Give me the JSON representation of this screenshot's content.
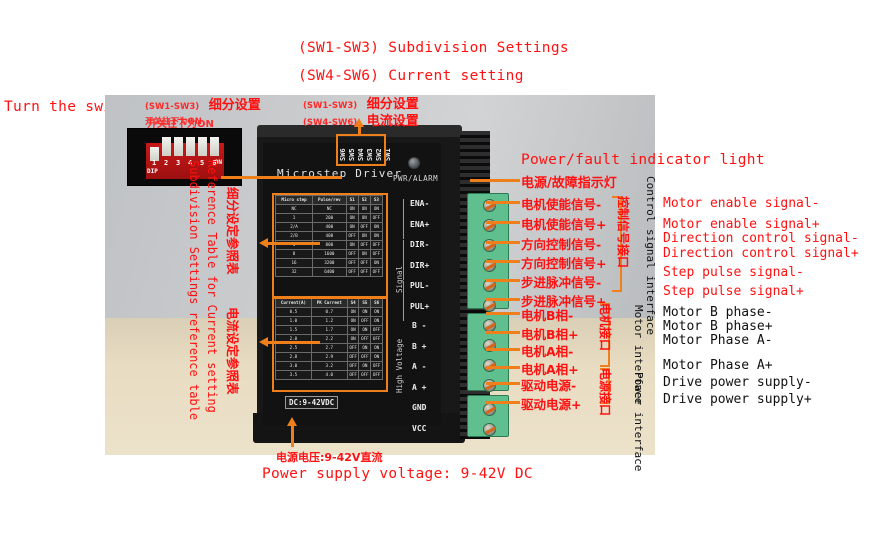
{
  "annotations": {
    "top": {
      "en_line1": "(SW1-SW3) Subdivision Settings",
      "en_line2": "(SW4-SW6) Current setting",
      "cn_line1_prefix": "(SW1-SW3)",
      "cn_line1": "细分设置",
      "cn_line2_prefix": "(SW4-SW6)",
      "cn_line2": "电流设置"
    },
    "left": {
      "en_switch": "Turn the switch downwards to ON",
      "cn_switch": "开关往下为ON",
      "en_vertical": "Reference Table for Current setting",
      "en_vertical_2": "Subdivision Settings reference table",
      "cn_vertical_1": "细分设定参照表",
      "cn_vertical_2": "电流设定参照表"
    },
    "right": {
      "indicator_en": "Power/fault indicator light",
      "indicator_cn": "电源/故障指示灯",
      "signals_cn": [
        "电机使能信号-",
        "电机使能信号+",
        "方向控制信号-",
        "方向控制信号+",
        "步进脉冲信号-",
        "步进脉冲信号+",
        "电机B相-",
        "电机B相+",
        "电机A相-",
        "电机A相+",
        "驱动电源-",
        "驱动电源+"
      ],
      "signals_en": [
        "Motor enable signal-",
        "Motor enable signal+",
        "Direction control signal-",
        "Direction control signal+",
        "Step pulse signal-",
        "Step pulse signal+",
        "Motor B phase-",
        "Motor B phase+",
        "Motor Phase A-",
        "Motor Phase A+",
        "Drive power supply-",
        "Drive power supply+"
      ],
      "group_cn_1": "控制信号接口",
      "group_cn_2": "电机接口",
      "group_cn_3": "电源接口",
      "group_en_1": "Control signal interface",
      "group_en_2": "Motor interface",
      "group_en_3": "Power interface"
    },
    "bottom": {
      "cn": "电源电压:9-42V直流",
      "en": "Power supply voltage: 9-42V DC"
    }
  },
  "device": {
    "title": "Microstep Driver",
    "led_label": "PWR/ALARM",
    "dc_label": "DC:9-42VDC",
    "signal_label": "Signal",
    "high_voltage_label": "High Voltage",
    "sw_labels": [
      "SW6",
      "SW5",
      "SW4",
      "SW3",
      "SW2",
      "SW1"
    ],
    "dip_numbers": [
      "1",
      "2",
      "3",
      "4",
      "5",
      "6"
    ],
    "dip_caption": "DIP",
    "dip_on": "ON",
    "pins_signal": [
      "ENA-",
      "ENA+",
      "DIR-",
      "DIR+",
      "PUL-",
      "PUL+"
    ],
    "pins_power": [
      "B -",
      "B +",
      "A -",
      "A +",
      "GND",
      "VCC"
    ],
    "microstep_table": {
      "headers": [
        "Micro step",
        "Pulse/rev",
        "S1",
        "S2",
        "S3"
      ],
      "rows": [
        [
          "NC",
          "NC",
          "ON",
          "ON",
          "ON"
        ],
        [
          "1",
          "200",
          "ON",
          "ON",
          "OFF"
        ],
        [
          "2/A",
          "400",
          "ON",
          "OFF",
          "ON"
        ],
        [
          "2/B",
          "400",
          "OFF",
          "ON",
          "ON"
        ],
        [
          "4",
          "800",
          "ON",
          "OFF",
          "OFF"
        ],
        [
          "8",
          "1600",
          "OFF",
          "ON",
          "OFF"
        ],
        [
          "16",
          "3200",
          "OFF",
          "OFF",
          "ON"
        ],
        [
          "32",
          "6400",
          "OFF",
          "OFF",
          "OFF"
        ]
      ]
    },
    "current_table": {
      "headers": [
        "Current(A)",
        "PK Current",
        "S4",
        "S5",
        "S6"
      ],
      "rows": [
        [
          "0.5",
          "0.7",
          "ON",
          "ON",
          "ON"
        ],
        [
          "1.0",
          "1.2",
          "ON",
          "OFF",
          "ON"
        ],
        [
          "1.5",
          "1.7",
          "ON",
          "ON",
          "OFF"
        ],
        [
          "2.0",
          "2.2",
          "ON",
          "OFF",
          "OFF"
        ],
        [
          "2.5",
          "2.7",
          "OFF",
          "ON",
          "ON"
        ],
        [
          "2.8",
          "2.9",
          "OFF",
          "OFF",
          "ON"
        ],
        [
          "3.0",
          "3.2",
          "OFF",
          "ON",
          "OFF"
        ],
        [
          "3.5",
          "4.0",
          "OFF",
          "OFF",
          "OFF"
        ]
      ]
    }
  },
  "colors": {
    "annotation_red": "#ff1111",
    "callout_orange": "#ef7f1a",
    "annotation_black": "#111111",
    "terminal_green": "#5fbf8e"
  }
}
